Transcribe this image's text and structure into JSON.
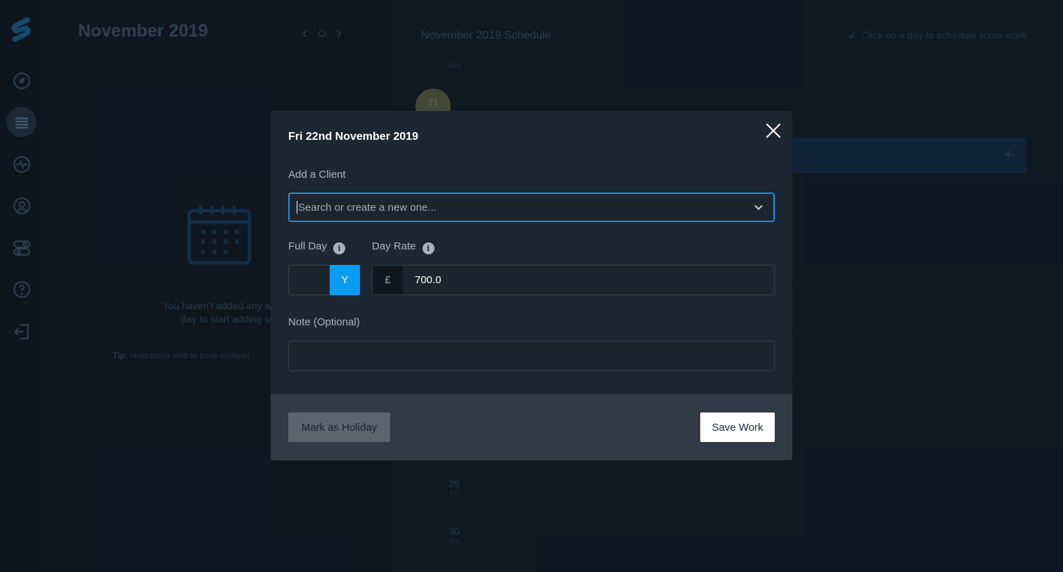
{
  "sidebar": {
    "logo_icon": "stride-logo-icon",
    "items": [
      {
        "name": "dashboard",
        "icon": "speedometer-icon"
      },
      {
        "name": "schedule",
        "icon": "list-icon",
        "active": true
      },
      {
        "name": "activity",
        "icon": "pulse-icon"
      },
      {
        "name": "profile",
        "icon": "user-circle-icon"
      },
      {
        "name": "settings",
        "icon": "toggles-icon"
      },
      {
        "name": "help",
        "icon": "help-icon"
      },
      {
        "name": "logout",
        "icon": "logout-icon"
      }
    ]
  },
  "left_panel": {
    "month_title": "November 2019",
    "empty_message_line1": "You haven't added any work yet",
    "empty_message_line2": "day to start adding som",
    "tip_label": "Tip:",
    "tip_text": "Hold down shift to book multiple"
  },
  "schedule": {
    "title": "November 2019 Schedule",
    "hint": "Click on a day to schedule some work",
    "header_dow": "Wed",
    "today_num": "21",
    "days": [
      {
        "num": "29",
        "dow": "Fri"
      },
      {
        "num": "30",
        "dow": "Sat"
      }
    ]
  },
  "modal": {
    "title": "Fri 22nd November 2019",
    "client_label": "Add a Client",
    "client_placeholder": "Search or create a new one...",
    "full_day_label": "Full Day",
    "full_day_value": "Y",
    "day_rate_label": "Day Rate",
    "currency_symbol": "£",
    "day_rate_value": "700.0",
    "note_label": "Note (Optional)",
    "note_value": "",
    "holiday_button": "Mark as Holiday",
    "save_button": "Save Work"
  },
  "colors": {
    "accent": "#0a9cf2",
    "focus_border": "#1e8ee0",
    "modal_bg": "#1c2733",
    "footer_bg": "#303b47"
  }
}
